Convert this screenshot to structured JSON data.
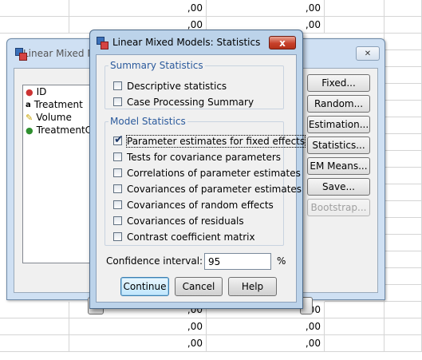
{
  "spreadsheet": {
    "cell_value": ",00",
    "rows": [
      ",00",
      ",00",
      ",00",
      ",00"
    ]
  },
  "back_dialog": {
    "title": "Linear Mixed M",
    "variables": [
      "ID",
      "Treatment",
      "Volume",
      "TreatmentC"
    ],
    "buttons": [
      "Fixed...",
      "Random...",
      "Estimation...",
      "Statistics...",
      "EM Means...",
      "Save...",
      "Bootstrap..."
    ]
  },
  "dialog": {
    "title": "Linear Mixed Models: Statistics",
    "close_label": "x",
    "summary_statistics": {
      "legend": "Summary Statistics",
      "items": [
        {
          "label": "Descriptive statistics",
          "checked": false
        },
        {
          "label": "Case Processing Summary",
          "checked": false
        }
      ]
    },
    "model_statistics": {
      "legend": "Model Statistics",
      "items": [
        {
          "label": "Parameter estimates for fixed effects",
          "checked": true
        },
        {
          "label": "Tests for covariance parameters",
          "checked": false
        },
        {
          "label": "Correlations of parameter estimates",
          "checked": false
        },
        {
          "label": "Covariances of parameter estimates",
          "checked": false
        },
        {
          "label": "Covariances of random effects",
          "checked": false
        },
        {
          "label": "Covariances of residuals",
          "checked": false
        },
        {
          "label": "Contrast coefficient matrix",
          "checked": false
        }
      ]
    },
    "confidence_interval": {
      "label": "Confidence interval:",
      "value": "95",
      "unit": "%"
    },
    "buttons": {
      "continue": "Continue",
      "cancel": "Cancel",
      "help": "Help"
    }
  },
  "colors": {
    "legend": "#2b5a9c",
    "close_button": "#c8412b",
    "titlebar": "#bcd3ea"
  }
}
